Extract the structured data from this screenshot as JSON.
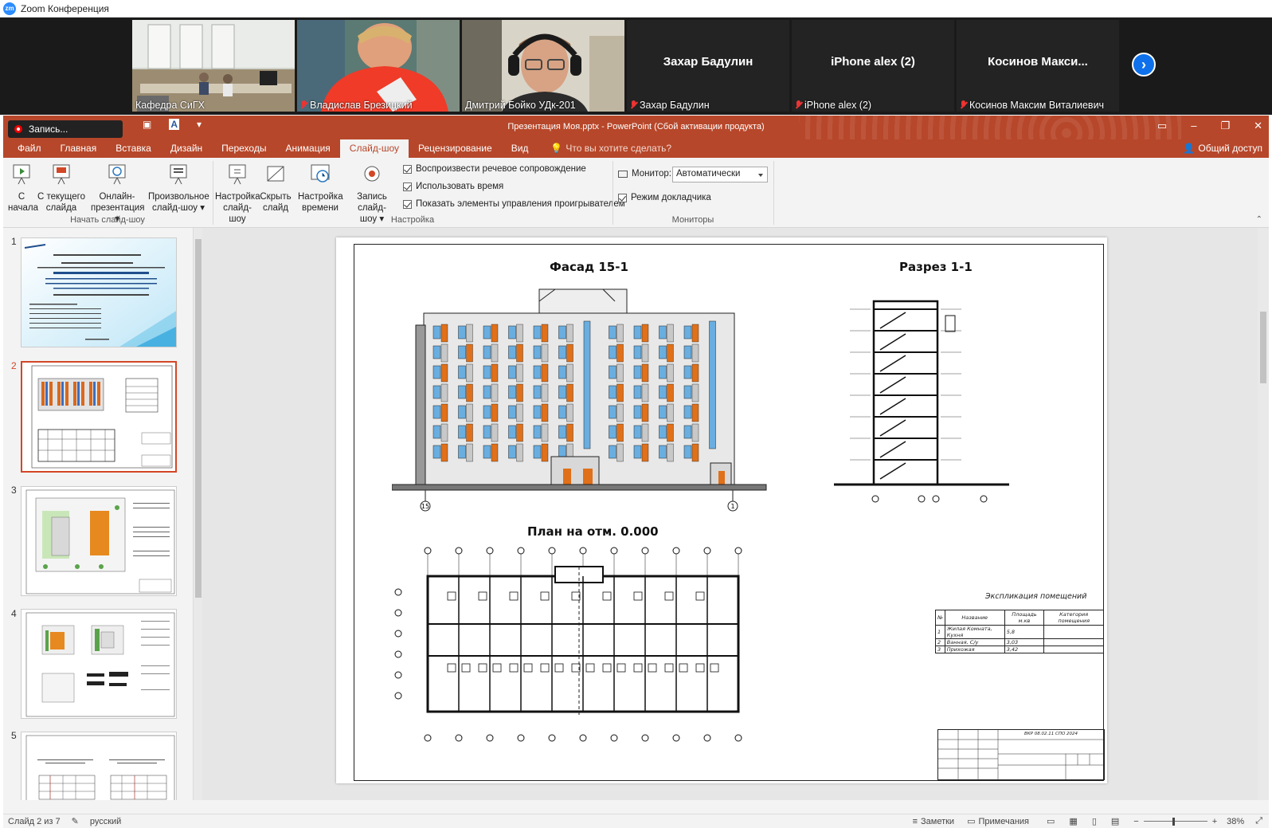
{
  "zoom": {
    "logo": "zm",
    "title": "Zoom Конференция",
    "participants": [
      {
        "name": "Кафедра СиГХ",
        "muted": false,
        "video": true
      },
      {
        "name": "Владислав Брезицкий",
        "muted": true,
        "video": true
      },
      {
        "name": "Дмитрий Бойко УДк-201",
        "muted": false,
        "video": true,
        "active": true
      },
      {
        "name": "Захар Бадулин",
        "muted": true,
        "video": false
      },
      {
        "name": "iPhone alex (2)",
        "muted": true,
        "video": false
      },
      {
        "name": "Косинов Максим Виталиевич",
        "big_name": "Косинов Макси...",
        "muted": true,
        "video": false
      }
    ],
    "next_icon": "chevron-right-icon"
  },
  "recording": {
    "label": "Запись..."
  },
  "ppt": {
    "doc_title": "Презентация Моя.pptx - PowerPoint (Сбой активации продукта)",
    "tabs": [
      "Файл",
      "Главная",
      "Вставка",
      "Дизайн",
      "Переходы",
      "Анимация",
      "Слайд-шоу",
      "Рецензирование",
      "Вид"
    ],
    "active_tab": "Слайд-шоу",
    "tell_me": "Что вы хотите сделать?",
    "share": "Общий доступ",
    "ribbon": {
      "start_group": {
        "label": "Начать слайд-шоу",
        "from_start": [
          "С",
          "начала"
        ],
        "from_current": [
          "С текущего",
          "слайда"
        ],
        "online": [
          "Онлайн-",
          "презентация ▾"
        ],
        "custom": [
          "Произвольное",
          "слайд-шоу ▾"
        ]
      },
      "setup_group": {
        "label": "Настройка",
        "setup_show": [
          "Настройка",
          "слайд-шоу"
        ],
        "hide_slide": [
          "Скрыть",
          "слайд"
        ],
        "rehearse": [
          "Настройка",
          "времени"
        ],
        "record": [
          "Запись слайд-",
          "шоу ▾"
        ],
        "play_narration": "Воспроизвести речевое сопровождение",
        "use_timings": "Использовать время",
        "show_media_controls": "Показать элементы управления проигрывателем"
      },
      "monitors_group": {
        "label": "Мониторы",
        "monitor_label": "Монитор:",
        "monitor_value": "Автоматически",
        "presenter_view": "Режим докладчика"
      }
    },
    "thumbnails": [
      1,
      2,
      3,
      4,
      5
    ],
    "selected_slide": 2,
    "slide": {
      "facade_title": "Фасад 15-1",
      "section_title": "Разрез 1-1",
      "plan_title": "План на отм. 0.000",
      "explication_title": "Экспликация помещений",
      "explication_headers": [
        "№",
        "Название",
        "Площадь м.кв",
        "Категория помещения"
      ],
      "explication_rows": [
        [
          "1",
          "Жилая Комната, Кухня",
          "5,8",
          ""
        ],
        [
          "2",
          "Ванная, С/у",
          "3,03",
          ""
        ],
        [
          "3",
          "Прихожая",
          "3,42",
          ""
        ]
      ],
      "stamp_code": "ВКР 08.02.11 СПО 2024",
      "axis_left": "15",
      "axis_right": "1"
    },
    "status": {
      "slide_of": "Слайд 2 из 7",
      "language": "русский",
      "notes": "Заметки",
      "comments": "Примечания",
      "zoom": "38%"
    }
  }
}
